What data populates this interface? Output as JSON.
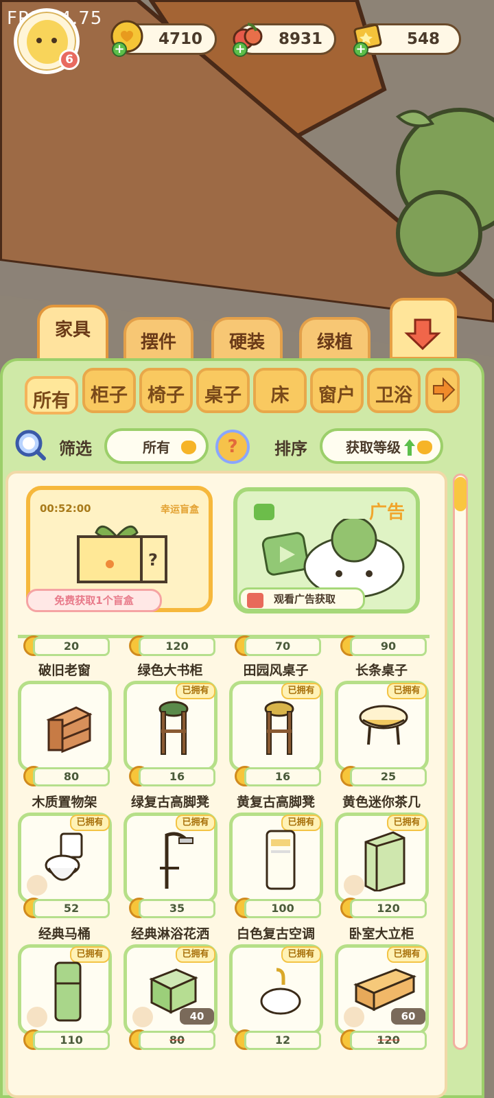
{
  "overlay": {
    "fps": "FPS:24.75"
  },
  "player": {
    "level": "6"
  },
  "resources": {
    "coins": "4710",
    "fruit": "8931",
    "tickets": "548"
  },
  "category_tabs": [
    "家具",
    "摆件",
    "硬装",
    "绿植"
  ],
  "sub_tabs": [
    "所有",
    "柜子",
    "椅子",
    "桌子",
    "床",
    "窗户",
    "卫浴"
  ],
  "filter": {
    "label": "筛选",
    "value": "所有"
  },
  "sort": {
    "label": "排序",
    "value": "获取等级"
  },
  "blind_box": {
    "timer": "00:52:00",
    "title": "幸运盲盒",
    "button": "免费获取1个盲盒"
  },
  "ad": {
    "title": "广告",
    "button": "观看广告获取"
  },
  "owned_label": "已拥有",
  "items_row1": [
    {
      "price": "20",
      "name": "破旧老窗"
    },
    {
      "price": "120",
      "name": "绿色大书柜"
    },
    {
      "price": "70",
      "name": "田园风桌子"
    },
    {
      "price": "90",
      "name": "长条桌子"
    }
  ],
  "items_row2": [
    {
      "price": "80",
      "name": "木质置物架"
    },
    {
      "price": "16",
      "name": "绿复古高脚凳"
    },
    {
      "price": "16",
      "name": "黄复古高脚凳"
    },
    {
      "price": "25",
      "name": "黄色迷你茶几"
    }
  ],
  "items_row3": [
    {
      "price": "52",
      "name": "经典马桶"
    },
    {
      "price": "35",
      "name": "经典淋浴花洒"
    },
    {
      "price": "100",
      "name": "白色复古空调"
    },
    {
      "price": "120",
      "name": "卧室大立柜"
    }
  ],
  "items_row4": [
    {
      "price": "110",
      "sale": ""
    },
    {
      "price": "80",
      "sale": "40"
    },
    {
      "price": "12",
      "sale": ""
    },
    {
      "price": "120",
      "sale": "60"
    }
  ]
}
